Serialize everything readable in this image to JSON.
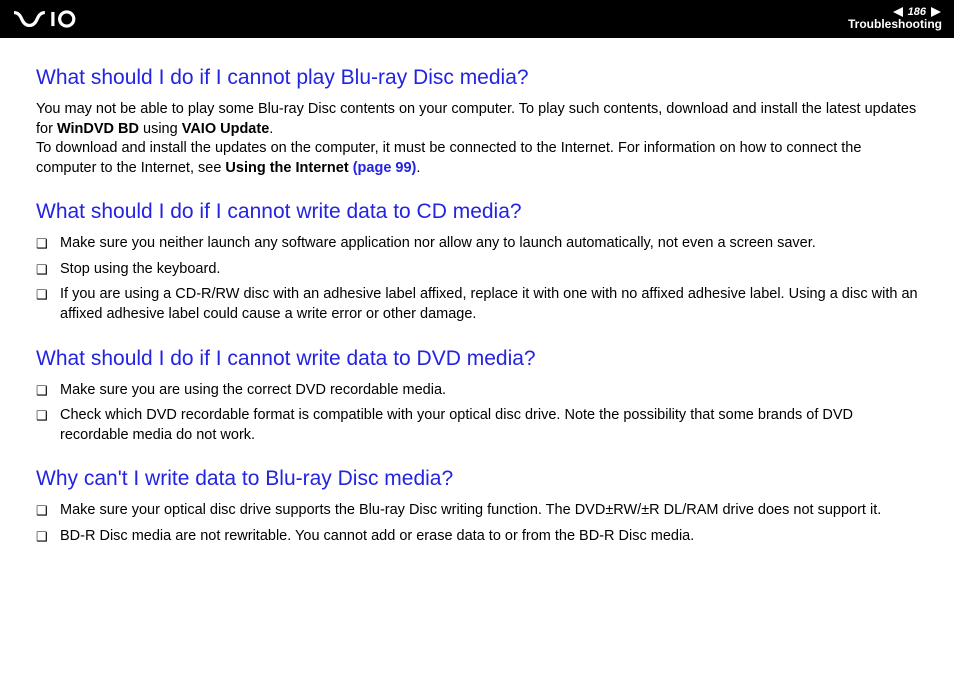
{
  "header": {
    "page_number": "186",
    "section": "Troubleshooting"
  },
  "sections": [
    {
      "heading": "What should I do if I cannot play Blu-ray Disc media?",
      "paragraph_parts": {
        "t1": "You may not be able to play some Blu-ray Disc contents on your computer. To play such contents, download and install the latest updates for ",
        "b1": "WinDVD BD",
        "t2": " using ",
        "b2": "VAIO Update",
        "t3": ".",
        "t4": "To download and install the updates on the computer, it must be connected to the Internet. For information on how to connect the computer to the Internet, see ",
        "b3": "Using the Internet ",
        "l1": "(page 99)",
        "t5": "."
      }
    },
    {
      "heading": "What should I do if I cannot write data to CD media?",
      "items": [
        "Make sure you neither launch any software application nor allow any to launch automatically, not even a screen saver.",
        "Stop using the keyboard.",
        "If you are using a CD-R/RW disc with an adhesive label affixed, replace it with one with no affixed adhesive label. Using a disc with an affixed adhesive label could cause a write error or other damage."
      ]
    },
    {
      "heading": "What should I do if I cannot write data to DVD media?",
      "items": [
        "Make sure you are using the correct DVD recordable media.",
        "Check which DVD recordable format is compatible with your optical disc drive. Note the possibility that some brands of DVD recordable media do not work."
      ]
    },
    {
      "heading": "Why can't I write data to Blu-ray Disc media?",
      "items": [
        "Make sure your optical disc drive supports the Blu-ray Disc writing function. The DVD±RW/±R DL/RAM drive does not support it.",
        "BD-R Disc media are not rewritable. You cannot add or erase data to or from the BD-R Disc media."
      ]
    }
  ]
}
